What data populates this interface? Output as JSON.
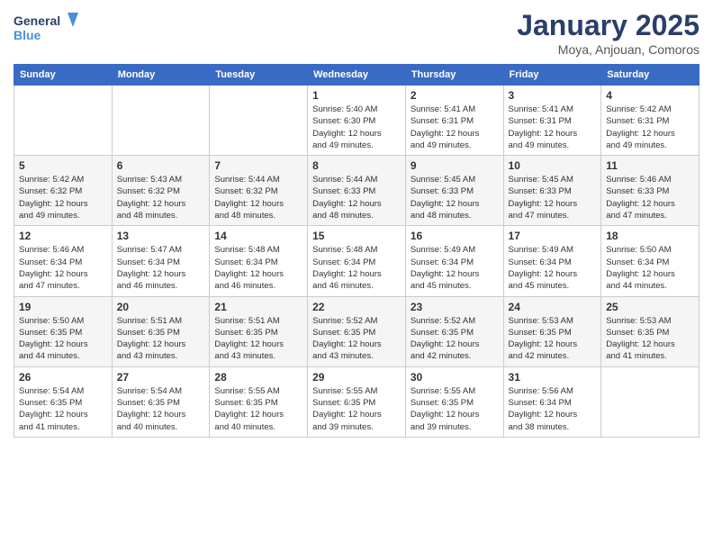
{
  "header": {
    "logo_general": "General",
    "logo_blue": "Blue",
    "title": "January 2025",
    "subtitle": "Moya, Anjouan, Comoros"
  },
  "weekdays": [
    "Sunday",
    "Monday",
    "Tuesday",
    "Wednesday",
    "Thursday",
    "Friday",
    "Saturday"
  ],
  "weeks": [
    [
      {
        "day": "",
        "info": ""
      },
      {
        "day": "",
        "info": ""
      },
      {
        "day": "",
        "info": ""
      },
      {
        "day": "1",
        "info": "Sunrise: 5:40 AM\nSunset: 6:30 PM\nDaylight: 12 hours\nand 49 minutes."
      },
      {
        "day": "2",
        "info": "Sunrise: 5:41 AM\nSunset: 6:31 PM\nDaylight: 12 hours\nand 49 minutes."
      },
      {
        "day": "3",
        "info": "Sunrise: 5:41 AM\nSunset: 6:31 PM\nDaylight: 12 hours\nand 49 minutes."
      },
      {
        "day": "4",
        "info": "Sunrise: 5:42 AM\nSunset: 6:31 PM\nDaylight: 12 hours\nand 49 minutes."
      }
    ],
    [
      {
        "day": "5",
        "info": "Sunrise: 5:42 AM\nSunset: 6:32 PM\nDaylight: 12 hours\nand 49 minutes."
      },
      {
        "day": "6",
        "info": "Sunrise: 5:43 AM\nSunset: 6:32 PM\nDaylight: 12 hours\nand 48 minutes."
      },
      {
        "day": "7",
        "info": "Sunrise: 5:44 AM\nSunset: 6:32 PM\nDaylight: 12 hours\nand 48 minutes."
      },
      {
        "day": "8",
        "info": "Sunrise: 5:44 AM\nSunset: 6:33 PM\nDaylight: 12 hours\nand 48 minutes."
      },
      {
        "day": "9",
        "info": "Sunrise: 5:45 AM\nSunset: 6:33 PM\nDaylight: 12 hours\nand 48 minutes."
      },
      {
        "day": "10",
        "info": "Sunrise: 5:45 AM\nSunset: 6:33 PM\nDaylight: 12 hours\nand 47 minutes."
      },
      {
        "day": "11",
        "info": "Sunrise: 5:46 AM\nSunset: 6:33 PM\nDaylight: 12 hours\nand 47 minutes."
      }
    ],
    [
      {
        "day": "12",
        "info": "Sunrise: 5:46 AM\nSunset: 6:34 PM\nDaylight: 12 hours\nand 47 minutes."
      },
      {
        "day": "13",
        "info": "Sunrise: 5:47 AM\nSunset: 6:34 PM\nDaylight: 12 hours\nand 46 minutes."
      },
      {
        "day": "14",
        "info": "Sunrise: 5:48 AM\nSunset: 6:34 PM\nDaylight: 12 hours\nand 46 minutes."
      },
      {
        "day": "15",
        "info": "Sunrise: 5:48 AM\nSunset: 6:34 PM\nDaylight: 12 hours\nand 46 minutes."
      },
      {
        "day": "16",
        "info": "Sunrise: 5:49 AM\nSunset: 6:34 PM\nDaylight: 12 hours\nand 45 minutes."
      },
      {
        "day": "17",
        "info": "Sunrise: 5:49 AM\nSunset: 6:34 PM\nDaylight: 12 hours\nand 45 minutes."
      },
      {
        "day": "18",
        "info": "Sunrise: 5:50 AM\nSunset: 6:34 PM\nDaylight: 12 hours\nand 44 minutes."
      }
    ],
    [
      {
        "day": "19",
        "info": "Sunrise: 5:50 AM\nSunset: 6:35 PM\nDaylight: 12 hours\nand 44 minutes."
      },
      {
        "day": "20",
        "info": "Sunrise: 5:51 AM\nSunset: 6:35 PM\nDaylight: 12 hours\nand 43 minutes."
      },
      {
        "day": "21",
        "info": "Sunrise: 5:51 AM\nSunset: 6:35 PM\nDaylight: 12 hours\nand 43 minutes."
      },
      {
        "day": "22",
        "info": "Sunrise: 5:52 AM\nSunset: 6:35 PM\nDaylight: 12 hours\nand 43 minutes."
      },
      {
        "day": "23",
        "info": "Sunrise: 5:52 AM\nSunset: 6:35 PM\nDaylight: 12 hours\nand 42 minutes."
      },
      {
        "day": "24",
        "info": "Sunrise: 5:53 AM\nSunset: 6:35 PM\nDaylight: 12 hours\nand 42 minutes."
      },
      {
        "day": "25",
        "info": "Sunrise: 5:53 AM\nSunset: 6:35 PM\nDaylight: 12 hours\nand 41 minutes."
      }
    ],
    [
      {
        "day": "26",
        "info": "Sunrise: 5:54 AM\nSunset: 6:35 PM\nDaylight: 12 hours\nand 41 minutes."
      },
      {
        "day": "27",
        "info": "Sunrise: 5:54 AM\nSunset: 6:35 PM\nDaylight: 12 hours\nand 40 minutes."
      },
      {
        "day": "28",
        "info": "Sunrise: 5:55 AM\nSunset: 6:35 PM\nDaylight: 12 hours\nand 40 minutes."
      },
      {
        "day": "29",
        "info": "Sunrise: 5:55 AM\nSunset: 6:35 PM\nDaylight: 12 hours\nand 39 minutes."
      },
      {
        "day": "30",
        "info": "Sunrise: 5:55 AM\nSunset: 6:35 PM\nDaylight: 12 hours\nand 39 minutes."
      },
      {
        "day": "31",
        "info": "Sunrise: 5:56 AM\nSunset: 6:34 PM\nDaylight: 12 hours\nand 38 minutes."
      },
      {
        "day": "",
        "info": ""
      }
    ]
  ]
}
